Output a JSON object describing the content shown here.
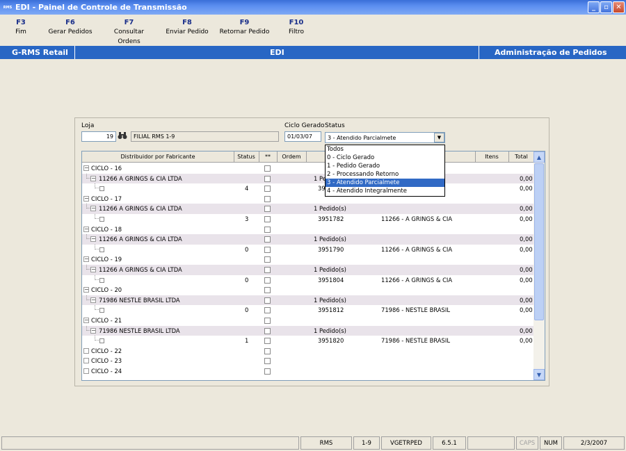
{
  "window": {
    "title": "EDI - Painel de Controle de Transmissão",
    "app_badge": "RMS",
    "btn_min": "_",
    "btn_max": "▫",
    "btn_close": "✕"
  },
  "fkeys": [
    {
      "key": "F3",
      "label": "Fim"
    },
    {
      "key": "F6",
      "label": "Gerar Pedidos"
    },
    {
      "key": "F7",
      "label": "Consultar Ordens"
    },
    {
      "key": "F8",
      "label": "Enviar Pedido"
    },
    {
      "key": "F9",
      "label": "Retornar Pedido"
    },
    {
      "key": "F10",
      "label": "Filtro"
    }
  ],
  "header": {
    "left": "G-RMS Retail",
    "center": "EDI",
    "right": "Administração de Pedidos"
  },
  "form": {
    "loja_label": "Loja",
    "loja_value": "19",
    "filial_value": "FILIAL RMS 1-9",
    "ciclo_label": "Ciclo Gerado",
    "ciclo_value": "01/03/07",
    "status_label": "Status",
    "status_value": "3 - Atendido Parcialmete",
    "dd_arrow": "▼"
  },
  "status_options": [
    "Todos",
    "0 - Ciclo Gerado",
    "1 - Pedido Gerado",
    "2 - Processando Retorno",
    "3 - Atendido Parcialmete",
    "4 - Atendido Integralmente"
  ],
  "grid": {
    "headers": {
      "distribuidor": "Distribuidor por Fabricante",
      "status": "Status",
      "star": "**",
      "ordem": "Ordem",
      "pedido": "Pe",
      "itens": "Itens",
      "total": "Total"
    },
    "rows": [
      {
        "kind": "ciclo",
        "label": "CICLO - 16",
        "exp": "−"
      },
      {
        "kind": "fab",
        "label": "11266 A GRINGS & CIA LTDA",
        "pedido": "1 Pe",
        "total": "0,00"
      },
      {
        "kind": "leaf",
        "status": "4",
        "pedido": "39",
        "fab": "CIA",
        "total": "0,00"
      },
      {
        "kind": "ciclo",
        "label": "CICLO - 17",
        "exp": "−"
      },
      {
        "kind": "fab",
        "label": "11266 A GRINGS & CIA LTDA",
        "pedido": "1 Pedido(s)",
        "total": "0,00"
      },
      {
        "kind": "leaf",
        "status": "3",
        "pedido": "3951782",
        "fab": "11266 - A GRINGS & CIA",
        "total": "0,00"
      },
      {
        "kind": "ciclo",
        "label": "CICLO - 18",
        "exp": "−"
      },
      {
        "kind": "fab",
        "label": "11266 A GRINGS & CIA LTDA",
        "pedido": "1 Pedido(s)",
        "total": "0,00"
      },
      {
        "kind": "leaf",
        "status": "0",
        "pedido": "3951790",
        "fab": "11266 - A GRINGS & CIA",
        "total": "0,00"
      },
      {
        "kind": "ciclo",
        "label": "CICLO - 19",
        "exp": "−"
      },
      {
        "kind": "fab",
        "label": "11266 A GRINGS & CIA LTDA",
        "pedido": "1 Pedido(s)",
        "total": "0,00"
      },
      {
        "kind": "leaf",
        "status": "0",
        "pedido": "3951804",
        "fab": "11266 - A GRINGS & CIA",
        "total": "0,00"
      },
      {
        "kind": "ciclo",
        "label": "CICLO - 20",
        "exp": "−"
      },
      {
        "kind": "fab",
        "label": "71986 NESTLE BRASIL LTDA",
        "pedido": "1 Pedido(s)",
        "total": "0,00"
      },
      {
        "kind": "leaf",
        "status": "0",
        "pedido": "3951812",
        "fab": "71986 - NESTLE BRASIL",
        "total": "0,00"
      },
      {
        "kind": "ciclo",
        "label": "CICLO - 21",
        "exp": "−"
      },
      {
        "kind": "fab",
        "label": "71986 NESTLE BRASIL LTDA",
        "pedido": "1 Pedido(s)",
        "total": "0,00"
      },
      {
        "kind": "leaf",
        "status": "1",
        "pedido": "3951820",
        "fab": "71986 - NESTLE BRASIL",
        "total": "0,00"
      },
      {
        "kind": "ciclo",
        "label": "CICLO - 22",
        "exp": ""
      },
      {
        "kind": "ciclo",
        "label": "CICLO - 23",
        "exp": ""
      },
      {
        "kind": "ciclo",
        "label": "CICLO - 24",
        "exp": ""
      }
    ],
    "scroll_up": "▲",
    "scroll_down": "▼"
  },
  "statusbar": {
    "system": "RMS",
    "filial": "1-9",
    "program": "VGETRPED",
    "version": "6.5.1",
    "caps": "CAPS",
    "num": "NUM",
    "date": "2/3/2007"
  },
  "colors": {
    "header_blue": "#2866c4",
    "selected_blue": "#316ac5",
    "row_highlight": "#e9e3ea"
  }
}
